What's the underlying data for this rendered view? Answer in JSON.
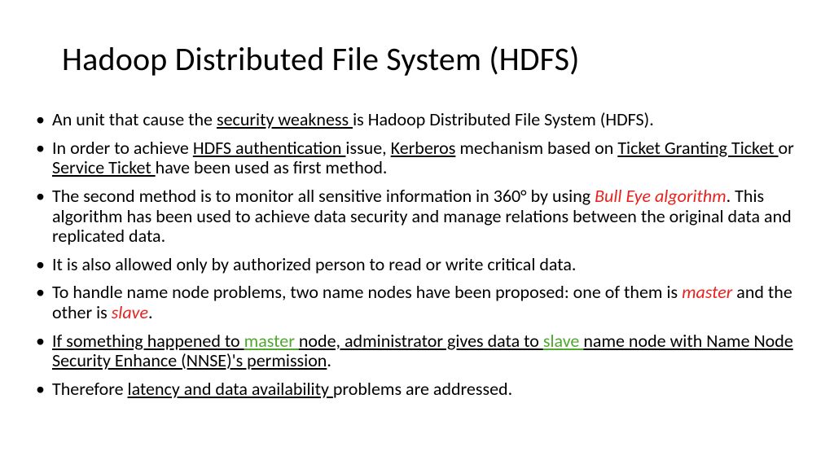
{
  "title": "Hadoop Distributed File System (HDFS)",
  "bullets": [
    {
      "segments": [
        {
          "t": "An unit that cause the ",
          "cls": ""
        },
        {
          "t": "security weakness ",
          "cls": "u"
        },
        {
          "t": "is Hadoop Distributed File System (HDFS).",
          "cls": ""
        }
      ]
    },
    {
      "segments": [
        {
          "t": "In order to achieve ",
          "cls": ""
        },
        {
          "t": "HDFS authentication ",
          "cls": "u"
        },
        {
          "t": "issue, ",
          "cls": ""
        },
        {
          "t": "Kerberos",
          "cls": "u"
        },
        {
          "t": " mechanism based on ",
          "cls": ""
        },
        {
          "t": "Ticket Granting Ticket ",
          "cls": "u"
        },
        {
          "t": "or ",
          "cls": ""
        },
        {
          "t": "Service Ticket ",
          "cls": "u"
        },
        {
          "t": "have been used as first method.",
          "cls": ""
        }
      ]
    },
    {
      "segments": [
        {
          "t": "The second method is to monitor all sensitive information in 360° by using ",
          "cls": ""
        },
        {
          "t": "Bull Eye algorithm",
          "cls": "red"
        },
        {
          "t": ". This algorithm has been used to achieve data security and manage relations between the original data and replicated data.",
          "cls": ""
        }
      ]
    },
    {
      "segments": [
        {
          "t": "It is also allowed only by authorized person to read or write critical data.",
          "cls": ""
        }
      ]
    },
    {
      "segments": [
        {
          "t": "To handle name node problems, two name nodes have been proposed: one of them is ",
          "cls": ""
        },
        {
          "t": "master",
          "cls": "red"
        },
        {
          "t": " and the other is ",
          "cls": ""
        },
        {
          "t": "slave",
          "cls": "red"
        },
        {
          "t": ".",
          "cls": ""
        }
      ]
    },
    {
      "segments": [
        {
          "t": "If something happened to ",
          "cls": "u"
        },
        {
          "t": "master ",
          "cls": "u green"
        },
        {
          "t": "node, administrator gives data to ",
          "cls": "u"
        },
        {
          "t": "slave ",
          "cls": "u green"
        },
        {
          "t": "name node with Name Node Security Enhance (NNSE)'s permission",
          "cls": "u"
        },
        {
          "t": ".",
          "cls": ""
        }
      ]
    },
    {
      "segments": [
        {
          "t": "Therefore ",
          "cls": ""
        },
        {
          "t": "latency and data availability ",
          "cls": "u"
        },
        {
          "t": "problems are addressed.",
          "cls": ""
        }
      ]
    }
  ]
}
